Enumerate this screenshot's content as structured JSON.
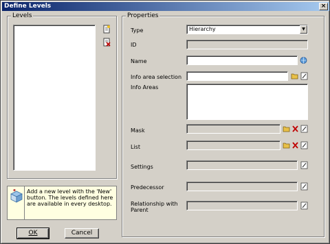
{
  "window": {
    "title": "Define Levels",
    "close_glyph": "×"
  },
  "levels": {
    "group_label": "Levels",
    "tool_icons": [
      "new-document-icon",
      "delete-document-icon"
    ]
  },
  "info": {
    "icon": "info-box-icon",
    "text": "Add a new level with the 'New' button. The levels defined here are available in every desktop."
  },
  "buttons": {
    "ok": "OK",
    "cancel": "Cancel"
  },
  "properties": {
    "group_label": "Properties",
    "type_label": "Type",
    "type_value": "Hierarchy",
    "id_label": "ID",
    "name_label": "Name",
    "info_area_selection_label": "Info area selection",
    "info_areas_label": "Info Areas",
    "mask_label": "Mask",
    "list_label": "List",
    "settings_label": "Settings",
    "predecessor_label": "Predecessor",
    "relationship_label": "Relationship with Parent"
  },
  "colors": {
    "dialog": "#d4d0c8",
    "title_start": "#0a246a",
    "title_end": "#a6caf0",
    "info_bg": "#ffffe1"
  }
}
